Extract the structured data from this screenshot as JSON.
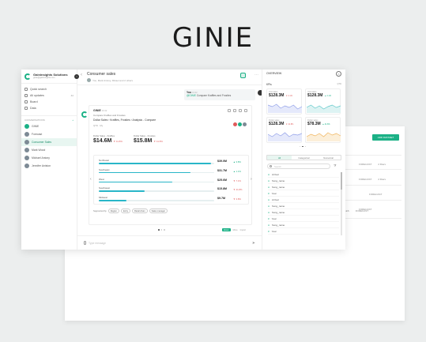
{
  "brand": "GINIE",
  "sidebar": {
    "org_name": "Gaininsights Solutions",
    "org_email": "ginie@gaininsights.com",
    "items": [
      {
        "label": "Quick search",
        "count": ""
      },
      {
        "label": "All updates",
        "count": "42"
      },
      {
        "label": "Board",
        "count": ""
      },
      {
        "label": "Data",
        "count": ""
      }
    ],
    "conversations_label": "CONVERSATIONS",
    "conversations": [
      "GINIE",
      "Forecast",
      "Consumer Sales",
      "Mark Wood",
      "Michael Antony",
      "Jennifer Aniston"
    ]
  },
  "chat": {
    "title": "Consumer sales",
    "participants": "You, Mark Antony, Micael and 2 others",
    "you_label": "You",
    "you_time": "10:42",
    "you_query_mention": "@GINIE",
    "you_query_text": "Compare Krafftes and Frosties",
    "ginie_label": "GINIE",
    "ginie_time": "10:42",
    "card_subtitle": "Compare Kraffies and Frosties",
    "card_path": "Dollar Sales › Kraffies, Frosties › Analysis - Compare",
    "card_filters": "QTD  ·  My",
    "metrics": [
      {
        "label": "Dollar Sales - Kraffies",
        "value": "$14.6M",
        "change": "▼ 41.8%"
      },
      {
        "label": "Dollar Sales - Frosties",
        "value": "$15.8M",
        "change": "▼ 41.8%"
      }
    ],
    "chart_data": {
      "type": "bar",
      "categories": [
        "Northeast",
        "Southeast",
        "West",
        "Southwest",
        "Midwest"
      ],
      "values": [
        39.0,
        31.7,
        25.6,
        15.8,
        9.7
      ],
      "value_labels": [
        "$39.0M",
        "$31.7M",
        "$25.6M",
        "$15.8M",
        "$9.7M"
      ],
      "changes": [
        "▲ 3.8%",
        "▲ 1.1%",
        "▼ 7.1%",
        "▼ 41.8%",
        "▼ 3.8%"
      ],
      "change_dirs": [
        "up",
        "up",
        "down",
        "down",
        "down"
      ],
      "xmax": 40
    },
    "segment_label": "Segmented by",
    "segments": [
      "Region",
      "Entry",
      "Retail chain",
      "Sales manager"
    ],
    "zoom_btn": "Zoom",
    "zoom_more": "More",
    "zoom_pct": "Import",
    "input_placeholder": "Type message"
  },
  "overview": {
    "title": "OVERVIEW",
    "kpis_label": "KPIs",
    "kpis_period": "QTD",
    "cards": [
      {
        "label": "Unit sales",
        "value": "$128.3M",
        "change": "▼ 2.1%",
        "dir": "down",
        "color": "#8f9ee8",
        "fill": "#e5e9fb"
      },
      {
        "label": "Unit sales",
        "value": "$128.3M",
        "change": "▲ 2.1%",
        "dir": "up",
        "color": "#5ec7c9",
        "fill": "#ddf3f3"
      },
      {
        "label": "Dollar sales",
        "value": "$128.3M",
        "change": "▼ 41.8%",
        "dir": "down",
        "color": "#8f9ee8",
        "fill": "#e5e9fb"
      },
      {
        "label": "Dollar sales",
        "value": "$78.3M",
        "change": "▲ 41.8%",
        "dir": "up",
        "color": "#f0b35a",
        "fill": "#fcefd9"
      }
    ],
    "tabs": [
      "All",
      "Categorical",
      "Numerical"
    ],
    "search_placeholder": "Search",
    "fields": [
      {
        "kind": "A",
        "name": "Arrival"
      },
      {
        "kind": "A",
        "name": "Song_name"
      },
      {
        "kind": "A",
        "name": "Song_name"
      },
      {
        "kind": "#",
        "name": "Year"
      },
      {
        "kind": "A",
        "name": "Arrival"
      },
      {
        "kind": "A",
        "name": "Song_name"
      },
      {
        "kind": "A",
        "name": "Song_name"
      },
      {
        "kind": "#",
        "name": "Year"
      },
      {
        "kind": "A",
        "name": "Song_name"
      },
      {
        "kind": "#",
        "name": "Year"
      }
    ]
  },
  "background": {
    "add_button": "ADD DATASET",
    "rows": [
      {
        "a": "FORECAST",
        "b": "2 filters"
      },
      {
        "a": "FORECAST",
        "b": "2 filters"
      },
      {
        "a": "FORECAST",
        "b": ""
      },
      {
        "a": "FORECAST",
        "b": ""
      },
      {
        "a": "SALES",
        "b": "FORECAST"
      },
      {
        "a": "FORECAST",
        "b": "2 filters"
      }
    ]
  },
  "colors": {
    "accent": "#1bb186",
    "bar": "#29b6c8",
    "down": "#e05a5a"
  }
}
